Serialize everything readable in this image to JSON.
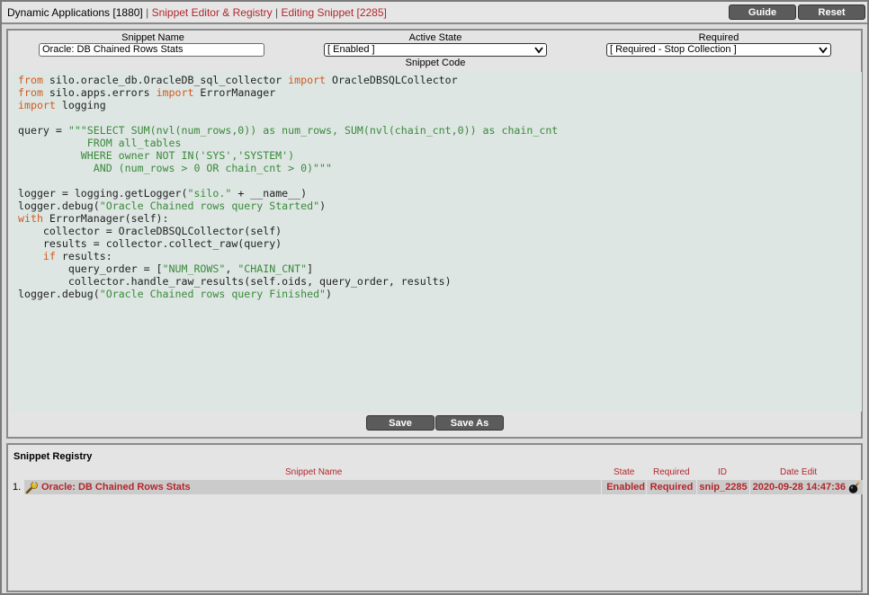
{
  "header": {
    "app_crumb": "Dynamic Applications [1880]",
    "separator": "|",
    "editor_crumb": "Snippet Editor & Registry",
    "editing_crumb": "Editing Snippet [2285]",
    "guide_label": "Guide",
    "reset_label": "Reset"
  },
  "form": {
    "name_label": "Snippet Name",
    "name_value": "Oracle: DB Chained Rows Stats",
    "state_label": "Active State",
    "state_value": "[ Enabled ]",
    "required_label": "Required",
    "required_value": "[ Required - Stop Collection ]",
    "code_label": "Snippet Code"
  },
  "code_lines": [
    [
      {
        "t": "from",
        "c": "kw"
      },
      {
        "t": " silo.oracle_db.OracleDB_sql_collector "
      },
      {
        "t": "import",
        "c": "kw"
      },
      {
        "t": " OracleDBSQLCollector"
      }
    ],
    [
      {
        "t": "from",
        "c": "kw"
      },
      {
        "t": " silo.apps.errors "
      },
      {
        "t": "import",
        "c": "kw"
      },
      {
        "t": " ErrorManager"
      }
    ],
    [
      {
        "t": "import",
        "c": "kw"
      },
      {
        "t": " logging"
      }
    ],
    [],
    [
      {
        "t": "query = "
      },
      {
        "t": "\"\"\"SELECT SUM(nvl(num_rows,0)) as num_rows, SUM(nvl(chain_cnt,0)) as chain_cnt",
        "c": "str"
      }
    ],
    [
      {
        "t": "           FROM all_tables",
        "c": "str"
      }
    ],
    [
      {
        "t": "          WHERE owner NOT IN('SYS','SYSTEM')",
        "c": "str"
      }
    ],
    [
      {
        "t": "            AND (num_rows > 0 OR chain_cnt > 0)\"\"\"",
        "c": "str"
      }
    ],
    [],
    [
      {
        "t": "logger = logging.getLogger("
      },
      {
        "t": "\"silo.\"",
        "c": "str"
      },
      {
        "t": " + __name__)"
      }
    ],
    [
      {
        "t": "logger.debug("
      },
      {
        "t": "\"Oracle Chained rows query Started\"",
        "c": "str"
      },
      {
        "t": ")"
      }
    ],
    [
      {
        "t": "with",
        "c": "kw"
      },
      {
        "t": " ErrorManager(self):"
      }
    ],
    [
      {
        "t": "    collector = OracleDBSQLCollector(self)"
      }
    ],
    [
      {
        "t": "    results = collector.collect_raw(query)"
      }
    ],
    [
      {
        "t": "    "
      },
      {
        "t": "if",
        "c": "kw"
      },
      {
        "t": " results:"
      }
    ],
    [
      {
        "t": "        query_order = ["
      },
      {
        "t": "\"NUM_ROWS\"",
        "c": "str"
      },
      {
        "t": ", "
      },
      {
        "t": "\"CHAIN_CNT\"",
        "c": "str"
      },
      {
        "t": "]"
      }
    ],
    [
      {
        "t": "        collector.handle_raw_results(self.oids, query_order, results)"
      }
    ],
    [
      {
        "t": "logger.debug("
      },
      {
        "t": "\"Oracle Chained rows query Finished\"",
        "c": "str"
      },
      {
        "t": ")"
      }
    ]
  ],
  "actions": {
    "save_label": "Save",
    "save_as_label": "Save As"
  },
  "registry": {
    "title": "Snippet Registry",
    "columns": {
      "name": "Snippet Name",
      "state": "State",
      "required": "Required",
      "id": "ID",
      "date": "Date Edit"
    },
    "rows": [
      {
        "index": "1.",
        "name": "Oracle: DB Chained Rows Stats",
        "state": "Enabled",
        "required": "Required",
        "id": "snip_2285",
        "date": "2020-09-28 14:47:36",
        "edit_icon": "wrench-icon",
        "action_icon": "bomb-icon"
      }
    ]
  },
  "colors": {
    "accent_red": "#b3262b",
    "keyword": "#d4591c",
    "string": "#3a8a3a",
    "code_bg": "#dde6e3"
  }
}
